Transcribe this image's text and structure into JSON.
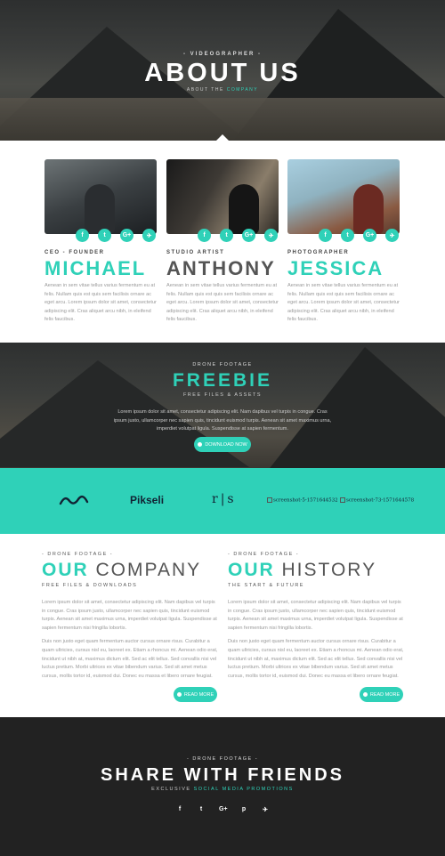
{
  "hero": {
    "kicker": "- VIDEOGRAPHER -",
    "title": "ABOUT US",
    "sub_prefix": "ABOUT THE",
    "sub_accent": "COMPANY"
  },
  "team": [
    {
      "role": "CEO - FOUNDER",
      "name": "MICHAEL",
      "bio": "Aenean in sem vitae tellus varius fermentum eu at felis. Nullam quis est quis sem facilisis ornare ac eget arcu. Lorem ipsum dolor sit amet, consectetur adipiscing elit. Cras aliquet arcu nibh, in eleifend felis faucibus."
    },
    {
      "role": "STUDIO ARTIST",
      "name": "ANTHONY",
      "bio": "Aenean in sem vitae tellus varius fermentum eu at felis. Nullam quis est quis sem facilisis ornare ac eget arcu. Lorem ipsum dolor sit amet, consectetur adipiscing elit. Cras aliquet arcu nibh, in eleifend felis faucibus."
    },
    {
      "role": "PHOTOGRAPHER",
      "name": "JESSICA",
      "bio": "Aenean in sem vitae tellus varius fermentum eu at felis. Nullam quis est quis sem facilisis ornare ac eget arcu. Lorem ipsum dolor sit amet, consectetur adipiscing elit. Cras aliquet arcu nibh, in eleifend felis faucibus."
    }
  ],
  "social": {
    "facebook": "f",
    "twitter": "t",
    "google_plus": "G+",
    "telegram": "✈"
  },
  "freebie": {
    "kicker": "DRONE FOOTAGE",
    "title": "FREEBIE",
    "sub": "FREE FILES & ASSETS",
    "text": "Lorem ipsum dolor sit amet, consectetur adipiscing elit. Nam dapibus vel turpis in congue. Cras ipsum justo, ullamcorper nec sapien quis, tincidunt euismod turpis. Aenean sit amet maximus urna, imperdiet volutpat ligula. Suspendisse at sapien fermentum.",
    "button": "DOWNLOAD NOW"
  },
  "logos": {
    "pikseli": "Pikseli",
    "rs": "r|s",
    "broken1": "screenshot-5-1571644532",
    "broken2": "screenshot-73-1571644578"
  },
  "company": {
    "kicker": "- DRONE FOOTAGE -",
    "title_a": "OUR",
    "title_b": "COMPANY",
    "tag": "FREE FILES & DOWNLOADS",
    "p1": "Lorem ipsum dolor sit amet, consectetur adipiscing elit. Nam dapibus vel turpis in congue. Cras ipsum justo, ullamcorper nec sapien quis, tincidunt euismod turpis. Aenean sit amet maximus urna, imperdiet volutpat ligula. Suspendisse at sapien fermentum nisi fringilla lobortis.",
    "p2": "Duis non justo eget quam fermentum auctor cursus ornare risus. Curabitur a quam ultricies, cursus nisl eu, laoreet ex. Etiam a rhoncus mi. Aenean odio erat, tincidunt ut nibh at, maximus dictum elit. Sed ac elit tellus. Sed convallis nisi vel luctus pretium. Morbi ultrices ex vitae bibendum varius. Sed sit amet metus cursus, mollis tortor id, euismod dui. Donec eu massa et libero ornare feugiat.",
    "button": "READ MORE"
  },
  "history": {
    "kicker": "- DRONE FOOTAGE -",
    "title_a": "OUR",
    "title_b": "HISTORY",
    "tag": "THE START & FUTURE",
    "p1": "Lorem ipsum dolor sit amet, consectetur adipiscing elit. Nam dapibus vel turpis in congue. Cras ipsum justo, ullamcorper nec sapien quis, tincidunt euismod turpis. Aenean sit amet maximus urna, imperdiet volutpat ligula. Suspendisse at sapien fermentum nisi fringilla lobortis.",
    "p2": "Duis non justo eget quam fermentum auctor cursus ornare risus. Curabitur a quam ultricies, cursus nisl eu, laoreet ex. Etiam a rhoncus mi. Aenean odio erat, tincidunt ut nibh at, maximus dictum elit. Sed ac elit tellus. Sed convallis nisi vel luctus pretium. Morbi ultrices ex vitae bibendum varius. Sed sit amet metus cursus, mollis tortor id, euismod dui. Donec eu massa et libero ornare feugiat.",
    "button": "READ MORE"
  },
  "share": {
    "kicker": "- DRONE FOOTAGE -",
    "title": "SHARE WITH FRIENDS",
    "sub_prefix": "EXCLUSIVE",
    "sub_accent": "SOCIAL MEDIA PROMOTIONS"
  },
  "colors": {
    "accent": "#2fd1b8",
    "dark": "#222222"
  }
}
